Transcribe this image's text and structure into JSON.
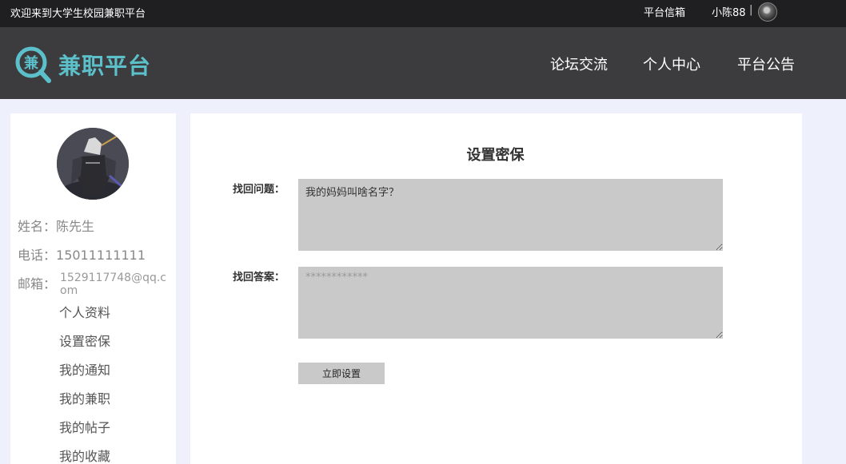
{
  "topbar": {
    "welcome": "欢迎来到大学生校园兼职平台",
    "mailbox": "平台信箱",
    "username": "小陈88",
    "separator": "|"
  },
  "header": {
    "logo_badge": "兼",
    "logo_text": "兼职平台",
    "nav": [
      "论坛交流",
      "个人中心",
      "平台公告"
    ]
  },
  "sidebar": {
    "name_label": "姓名：",
    "name_value": "陈先生",
    "phone_label": "电话：",
    "phone_value": "15011111111",
    "email_label": "邮箱：",
    "email_value": "1529117748@qq.com",
    "menu": [
      "个人资料",
      "设置密保",
      "我的通知",
      "我的兼职",
      "我的帖子",
      "我的收藏"
    ]
  },
  "main": {
    "title": "设置密保",
    "question_label": "找回问题：",
    "question_value": "我的妈妈叫啥名字？",
    "answer_label": "找回答案：",
    "answer_placeholder": "************",
    "submit_label": "立即设置"
  },
  "colors": {
    "topbar_bg": "#1f1f22",
    "header_bg": "#3c3c3e",
    "brand": "#5bc0c9",
    "page_bg": "#eef0fb",
    "field_bg": "#c9c9c9"
  }
}
